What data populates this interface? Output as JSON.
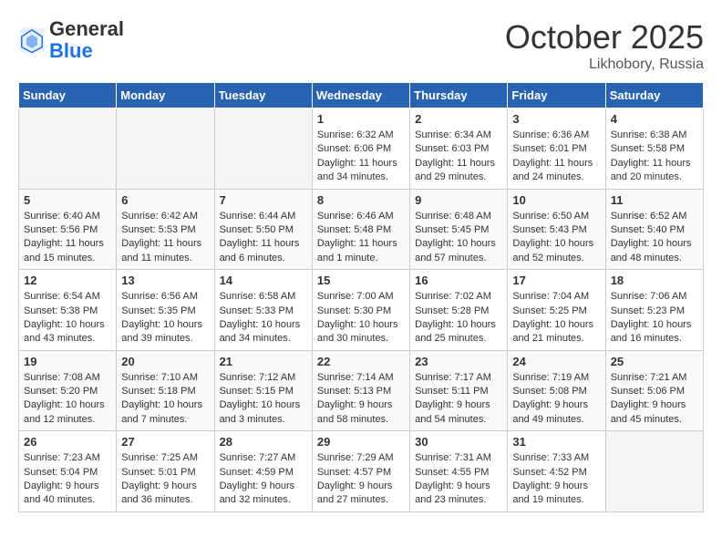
{
  "header": {
    "logo_general": "General",
    "logo_blue": "Blue",
    "month_title": "October 2025",
    "location": "Likhobory, Russia"
  },
  "days_of_week": [
    "Sunday",
    "Monday",
    "Tuesday",
    "Wednesday",
    "Thursday",
    "Friday",
    "Saturday"
  ],
  "weeks": [
    [
      {
        "day": "",
        "empty": true
      },
      {
        "day": "",
        "empty": true
      },
      {
        "day": "",
        "empty": true
      },
      {
        "day": "1",
        "sunrise": "Sunrise: 6:32 AM",
        "sunset": "Sunset: 6:06 PM",
        "daylight": "Daylight: 11 hours and 34 minutes."
      },
      {
        "day": "2",
        "sunrise": "Sunrise: 6:34 AM",
        "sunset": "Sunset: 6:03 PM",
        "daylight": "Daylight: 11 hours and 29 minutes."
      },
      {
        "day": "3",
        "sunrise": "Sunrise: 6:36 AM",
        "sunset": "Sunset: 6:01 PM",
        "daylight": "Daylight: 11 hours and 24 minutes."
      },
      {
        "day": "4",
        "sunrise": "Sunrise: 6:38 AM",
        "sunset": "Sunset: 5:58 PM",
        "daylight": "Daylight: 11 hours and 20 minutes."
      }
    ],
    [
      {
        "day": "5",
        "sunrise": "Sunrise: 6:40 AM",
        "sunset": "Sunset: 5:56 PM",
        "daylight": "Daylight: 11 hours and 15 minutes."
      },
      {
        "day": "6",
        "sunrise": "Sunrise: 6:42 AM",
        "sunset": "Sunset: 5:53 PM",
        "daylight": "Daylight: 11 hours and 11 minutes."
      },
      {
        "day": "7",
        "sunrise": "Sunrise: 6:44 AM",
        "sunset": "Sunset: 5:50 PM",
        "daylight": "Daylight: 11 hours and 6 minutes."
      },
      {
        "day": "8",
        "sunrise": "Sunrise: 6:46 AM",
        "sunset": "Sunset: 5:48 PM",
        "daylight": "Daylight: 11 hours and 1 minute."
      },
      {
        "day": "9",
        "sunrise": "Sunrise: 6:48 AM",
        "sunset": "Sunset: 5:45 PM",
        "daylight": "Daylight: 10 hours and 57 minutes."
      },
      {
        "day": "10",
        "sunrise": "Sunrise: 6:50 AM",
        "sunset": "Sunset: 5:43 PM",
        "daylight": "Daylight: 10 hours and 52 minutes."
      },
      {
        "day": "11",
        "sunrise": "Sunrise: 6:52 AM",
        "sunset": "Sunset: 5:40 PM",
        "daylight": "Daylight: 10 hours and 48 minutes."
      }
    ],
    [
      {
        "day": "12",
        "sunrise": "Sunrise: 6:54 AM",
        "sunset": "Sunset: 5:38 PM",
        "daylight": "Daylight: 10 hours and 43 minutes."
      },
      {
        "day": "13",
        "sunrise": "Sunrise: 6:56 AM",
        "sunset": "Sunset: 5:35 PM",
        "daylight": "Daylight: 10 hours and 39 minutes."
      },
      {
        "day": "14",
        "sunrise": "Sunrise: 6:58 AM",
        "sunset": "Sunset: 5:33 PM",
        "daylight": "Daylight: 10 hours and 34 minutes."
      },
      {
        "day": "15",
        "sunrise": "Sunrise: 7:00 AM",
        "sunset": "Sunset: 5:30 PM",
        "daylight": "Daylight: 10 hours and 30 minutes."
      },
      {
        "day": "16",
        "sunrise": "Sunrise: 7:02 AM",
        "sunset": "Sunset: 5:28 PM",
        "daylight": "Daylight: 10 hours and 25 minutes."
      },
      {
        "day": "17",
        "sunrise": "Sunrise: 7:04 AM",
        "sunset": "Sunset: 5:25 PM",
        "daylight": "Daylight: 10 hours and 21 minutes."
      },
      {
        "day": "18",
        "sunrise": "Sunrise: 7:06 AM",
        "sunset": "Sunset: 5:23 PM",
        "daylight": "Daylight: 10 hours and 16 minutes."
      }
    ],
    [
      {
        "day": "19",
        "sunrise": "Sunrise: 7:08 AM",
        "sunset": "Sunset: 5:20 PM",
        "daylight": "Daylight: 10 hours and 12 minutes."
      },
      {
        "day": "20",
        "sunrise": "Sunrise: 7:10 AM",
        "sunset": "Sunset: 5:18 PM",
        "daylight": "Daylight: 10 hours and 7 minutes."
      },
      {
        "day": "21",
        "sunrise": "Sunrise: 7:12 AM",
        "sunset": "Sunset: 5:15 PM",
        "daylight": "Daylight: 10 hours and 3 minutes."
      },
      {
        "day": "22",
        "sunrise": "Sunrise: 7:14 AM",
        "sunset": "Sunset: 5:13 PM",
        "daylight": "Daylight: 9 hours and 58 minutes."
      },
      {
        "day": "23",
        "sunrise": "Sunrise: 7:17 AM",
        "sunset": "Sunset: 5:11 PM",
        "daylight": "Daylight: 9 hours and 54 minutes."
      },
      {
        "day": "24",
        "sunrise": "Sunrise: 7:19 AM",
        "sunset": "Sunset: 5:08 PM",
        "daylight": "Daylight: 9 hours and 49 minutes."
      },
      {
        "day": "25",
        "sunrise": "Sunrise: 7:21 AM",
        "sunset": "Sunset: 5:06 PM",
        "daylight": "Daylight: 9 hours and 45 minutes."
      }
    ],
    [
      {
        "day": "26",
        "sunrise": "Sunrise: 7:23 AM",
        "sunset": "Sunset: 5:04 PM",
        "daylight": "Daylight: 9 hours and 40 minutes."
      },
      {
        "day": "27",
        "sunrise": "Sunrise: 7:25 AM",
        "sunset": "Sunset: 5:01 PM",
        "daylight": "Daylight: 9 hours and 36 minutes."
      },
      {
        "day": "28",
        "sunrise": "Sunrise: 7:27 AM",
        "sunset": "Sunset: 4:59 PM",
        "daylight": "Daylight: 9 hours and 32 minutes."
      },
      {
        "day": "29",
        "sunrise": "Sunrise: 7:29 AM",
        "sunset": "Sunset: 4:57 PM",
        "daylight": "Daylight: 9 hours and 27 minutes."
      },
      {
        "day": "30",
        "sunrise": "Sunrise: 7:31 AM",
        "sunset": "Sunset: 4:55 PM",
        "daylight": "Daylight: 9 hours and 23 minutes."
      },
      {
        "day": "31",
        "sunrise": "Sunrise: 7:33 AM",
        "sunset": "Sunset: 4:52 PM",
        "daylight": "Daylight: 9 hours and 19 minutes."
      },
      {
        "day": "",
        "empty": true
      }
    ]
  ]
}
